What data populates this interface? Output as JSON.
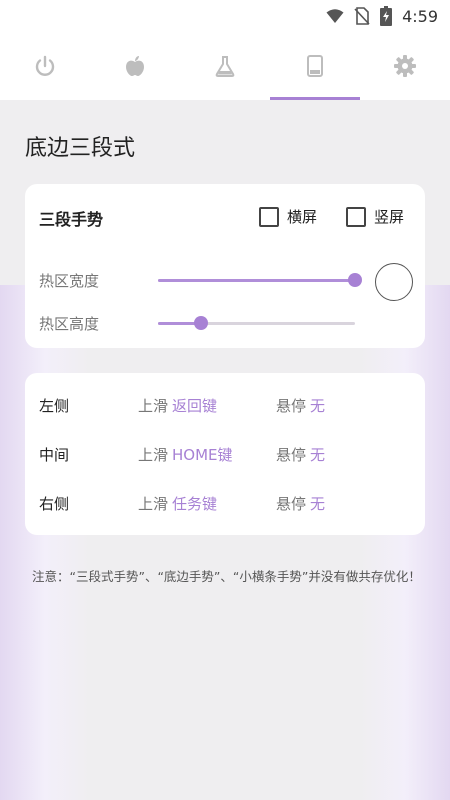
{
  "status_bar": {
    "time": "4:59",
    "icons": [
      "wifi-icon",
      "no-sim-icon",
      "battery-charging-icon"
    ]
  },
  "tabs": [
    {
      "icon": "power-icon",
      "active": false
    },
    {
      "icon": "apple-icon",
      "active": false
    },
    {
      "icon": "flask-icon",
      "active": false
    },
    {
      "icon": "phone-icon",
      "active": true
    },
    {
      "icon": "gear-icon",
      "active": false
    }
  ],
  "page": {
    "title": "底边三段式"
  },
  "gesture_card": {
    "heading": "三段手势",
    "landscape_label": "横屏",
    "landscape_checked": false,
    "portrait_label": "竖屏",
    "portrait_checked": false,
    "hotzone_width_label": "热区宽度",
    "hotzone_width_fraction": 1.0,
    "hotzone_height_label": "热区高度",
    "hotzone_height_fraction": 0.22
  },
  "actions_card": {
    "rows": [
      {
        "side": "左侧",
        "swipe_up_label": "上滑",
        "swipe_up_value": "返回键",
        "hover_label": "悬停",
        "hover_value": "无"
      },
      {
        "side": "中间",
        "swipe_up_label": "上滑",
        "swipe_up_value": "HOME键",
        "hover_label": "悬停",
        "hover_value": "无"
      },
      {
        "side": "右侧",
        "swipe_up_label": "上滑",
        "swipe_up_value": "任务键",
        "hover_label": "悬停",
        "hover_value": "无"
      }
    ]
  },
  "note": "注意：“三段式手势”、“底边手势”、“小横条手势”并没有做共存优化！",
  "colors": {
    "accent": "#a781d4",
    "background": "#efeef0",
    "card": "#ffffff"
  }
}
